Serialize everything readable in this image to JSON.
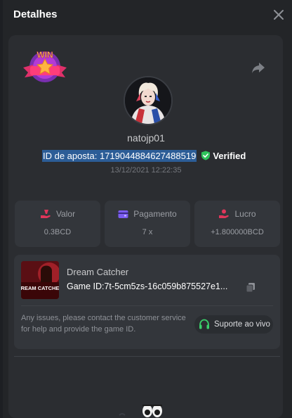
{
  "header": {
    "title": "Detalhes",
    "close_icon": "close-icon"
  },
  "bet": {
    "username": "natojp01",
    "bet_id_text": "ID de aposta: 1719044884627488519",
    "verified_label": "Verified",
    "date": "13/12/2021 12:22:35",
    "result_badge": "WIN"
  },
  "stats": [
    {
      "label": "Valor",
      "value": "0.3BCD",
      "icon": "money-hand-icon",
      "icon_color": "#e0365a"
    },
    {
      "label": "Pagamento",
      "value": "7 x",
      "icon": "wallet-icon",
      "icon_color": "#7b5cf0"
    },
    {
      "label": "Lucro",
      "value": "+1.800000BCD",
      "icon": "profit-hand-icon",
      "icon_color": "#e0365a"
    }
  ],
  "game": {
    "name": "Dream Catcher",
    "game_id_text": "Game ID:7t-5cm5zs-16c059b875527e1...",
    "thumbnail_text": "DREAM CATCHER",
    "issue_text": "Any issues, please contact the customer service for help and provide the game ID.",
    "support_label": "Suporte ao vivo"
  },
  "colors": {
    "background": "#232528",
    "card": "#2b2d31",
    "tile": "#33363b",
    "verified_green": "#2fc25b",
    "support_green": "#3ad06a",
    "highlight": "#2c5d97"
  }
}
